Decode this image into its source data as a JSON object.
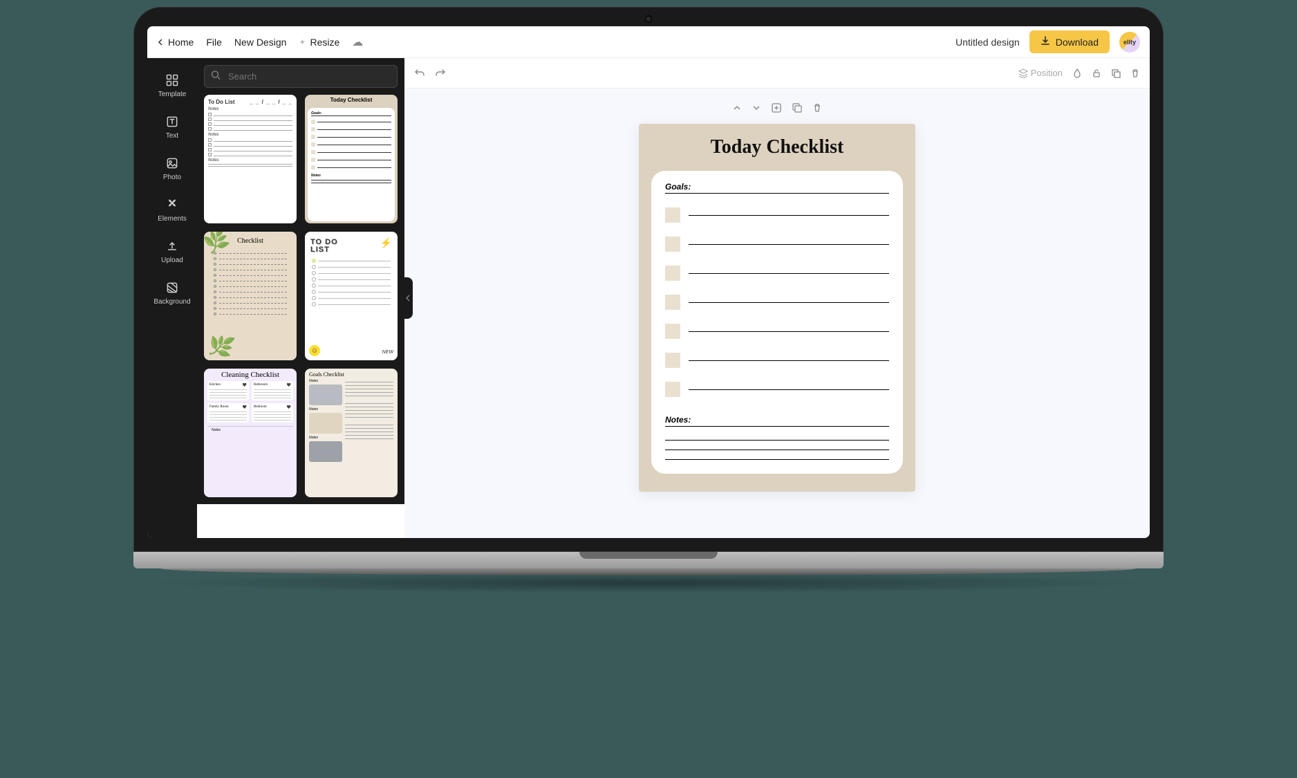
{
  "brand": "ellty",
  "topbar": {
    "home": "Home",
    "file": "File",
    "newDesign": "New Design",
    "resize": "Resize",
    "title": "Untitled design",
    "download": "Download"
  },
  "sidebar": {
    "items": [
      {
        "key": "template",
        "label": "Template"
      },
      {
        "key": "text",
        "label": "Text"
      },
      {
        "key": "photo",
        "label": "Photo"
      },
      {
        "key": "elements",
        "label": "Elements"
      },
      {
        "key": "upload",
        "label": "Upload"
      },
      {
        "key": "background",
        "label": "Background"
      }
    ]
  },
  "search": {
    "placeholder": "Search"
  },
  "templates": [
    {
      "title": "To Do List",
      "sections": [
        "Notes",
        "Notes",
        "Notes"
      ]
    },
    {
      "title": "Today Checklist",
      "goals_label": "Goals:",
      "notes_label": "Notes"
    },
    {
      "title": "Checklist"
    },
    {
      "title_line1": "TO DO",
      "title_line2": "LIST",
      "badge": "NEW"
    },
    {
      "title": "Cleaning Checklist",
      "areas": [
        "Kitchen",
        "Bathroom",
        "Family Room",
        "Bedroom"
      ],
      "notes": "Notes"
    },
    {
      "title": "Goals Checklist",
      "notes": "Notes"
    }
  ],
  "canvasToolbar": {
    "position": "Position"
  },
  "canvasPage": {
    "title": "Today Checklist",
    "goals_label": "Goals:",
    "notes_label": "Notes:",
    "checkbox_count": 7,
    "notes_lines": 3
  },
  "colors": {
    "accent": "#f6c647",
    "pageBg": "#ddd2bf",
    "checkbox": "#eae0d0"
  }
}
